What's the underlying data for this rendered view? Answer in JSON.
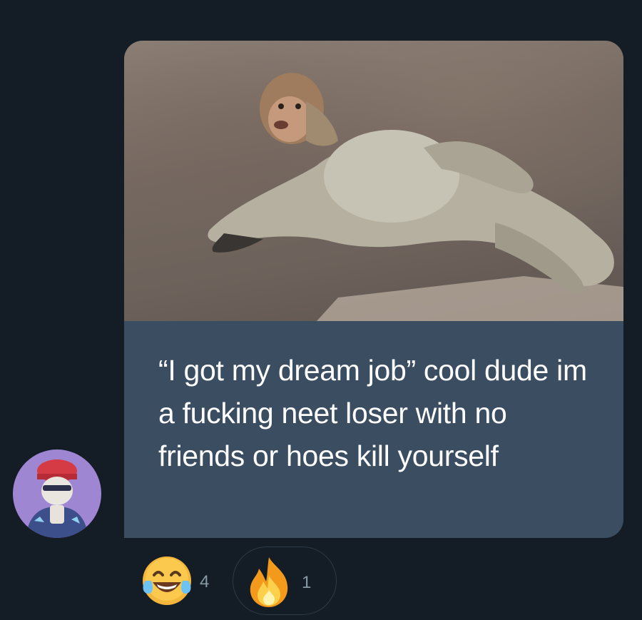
{
  "colors": {
    "background": "#141d26",
    "bubble": "#3b4d61",
    "text": "#ffffff",
    "muted": "#8899a6"
  },
  "message": {
    "sender_avatar_icon": "user-avatar",
    "image_icon": "photo-monkey",
    "text": "“I got my dream job” cool dude im a fucking neet loser with no friends or hoes kill yourself"
  },
  "reactions": [
    {
      "icon": "laughing-tears-emoji",
      "count": "4"
    },
    {
      "icon": "fire-emoji",
      "count": "1"
    }
  ]
}
